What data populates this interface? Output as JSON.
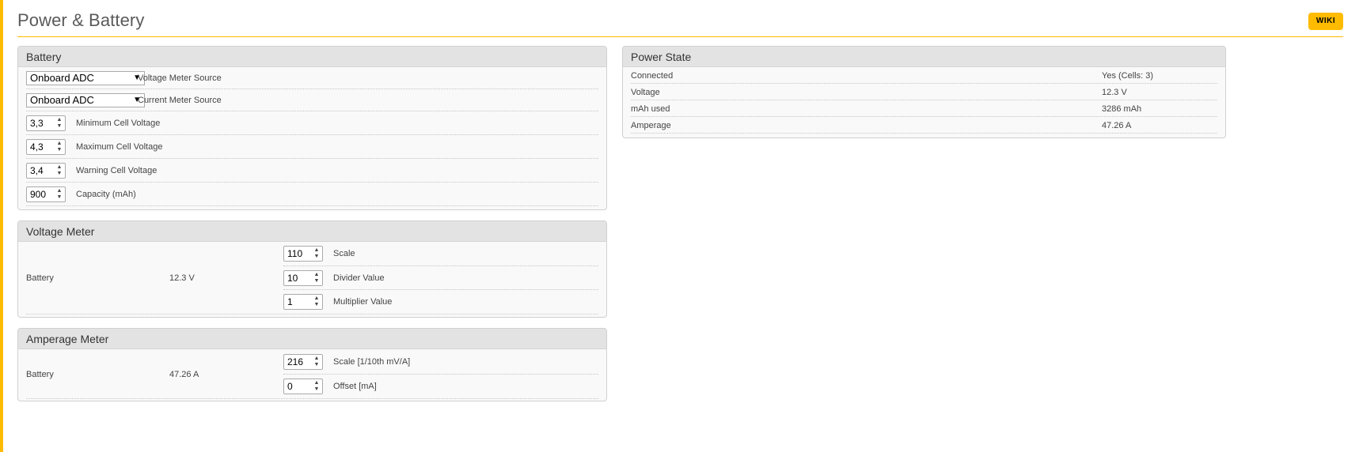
{
  "header": {
    "title": "Power & Battery",
    "wiki_label": "WIKI"
  },
  "battery": {
    "title": "Battery",
    "voltage_source": {
      "selected": "Onboard ADC",
      "label": "Voltage Meter Source"
    },
    "current_source": {
      "selected": "Onboard ADC",
      "label": "Current Meter Source"
    },
    "min_cell": {
      "value": "3,3",
      "label": "Minimum Cell Voltage"
    },
    "max_cell": {
      "value": "4,3",
      "label": "Maximum Cell Voltage"
    },
    "warn_cell": {
      "value": "3,4",
      "label": "Warning Cell Voltage"
    },
    "capacity": {
      "value": "900",
      "label": "Capacity (mAh)"
    }
  },
  "voltage_meter": {
    "title": "Voltage Meter",
    "source_label": "Battery",
    "reading": "12.3 V",
    "scale": {
      "value": "110",
      "label": "Scale"
    },
    "divider": {
      "value": "10",
      "label": "Divider Value"
    },
    "multiplier": {
      "value": "1",
      "label": "Multiplier Value"
    }
  },
  "amperage_meter": {
    "title": "Amperage Meter",
    "source_label": "Battery",
    "reading": "47.26 A",
    "scale": {
      "value": "216",
      "label": "Scale [1/10th mV/A]"
    },
    "offset": {
      "value": "0",
      "label": "Offset [mA]"
    }
  },
  "power_state": {
    "title": "Power State",
    "rows": [
      {
        "key": "Connected",
        "value": "Yes (Cells: 3)"
      },
      {
        "key": "Voltage",
        "value": "12.3 V"
      },
      {
        "key": "mAh used",
        "value": "3286 mAh"
      },
      {
        "key": "Amperage",
        "value": "47.26 A"
      }
    ]
  },
  "icons": {
    "dropdown": "chevron-down-icon",
    "spinner": "spinner-arrows-icon"
  },
  "colors": {
    "accent": "#ffbb00",
    "panel_header": "#e3e3e3",
    "panel_body": "#f9f9f9"
  }
}
